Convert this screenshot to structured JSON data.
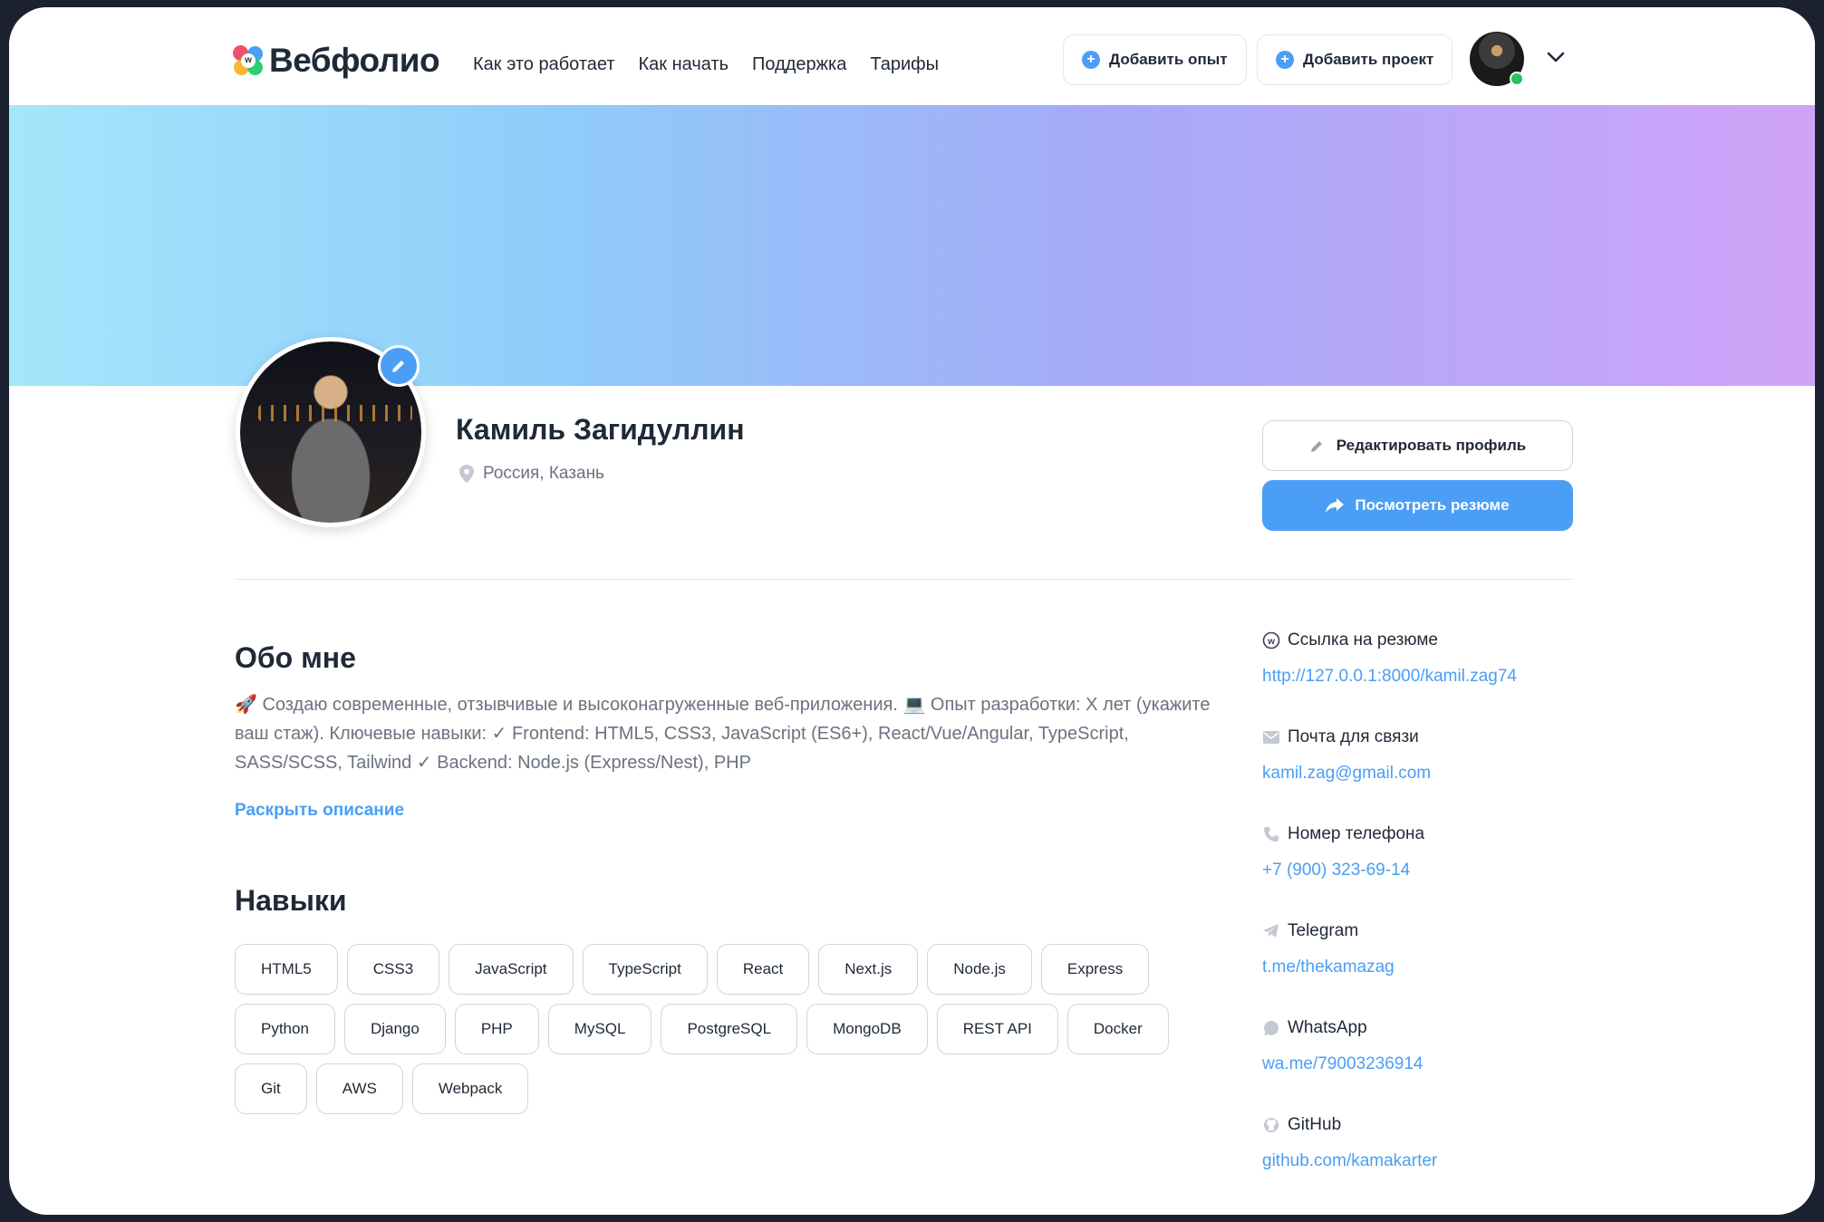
{
  "header": {
    "logo_text": "Вебфолио",
    "nav": [
      "Как это работает",
      "Как начать",
      "Поддержка",
      "Тарифы"
    ],
    "add_experience": "Добавить опыт",
    "add_project": "Добавить проект"
  },
  "profile": {
    "name": "Камиль Загидуллин",
    "location": "Россия, Казань",
    "edit_profile": "Редактировать профиль",
    "view_resume": "Посмотреть резюме"
  },
  "about": {
    "title": "Обо мне",
    "text": "🚀 Создаю современные, отзывчивые и высоконагруженные веб-приложения. 💻 Опыт разработки: X лет (укажите ваш стаж). Ключевые навыки: ✓ Frontend: HTML5, CSS3, JavaScript (ES6+), React/Vue/Angular, TypeScript, SASS/SCSS, Tailwind ✓ Backend: Node.js (Express/Nest), PHP",
    "reveal": "Раскрыть описание"
  },
  "skills": {
    "title": "Навыки",
    "rows": [
      [
        "HTML5",
        "CSS3",
        "JavaScript",
        "TypeScript",
        "React",
        "Next.js",
        "Node.js",
        "Express"
      ],
      [
        "Python",
        "Django",
        "PHP",
        "MySQL",
        "PostgreSQL",
        "MongoDB",
        "REST API",
        "Docker"
      ],
      [
        "Git",
        "AWS",
        "Webpack"
      ]
    ]
  },
  "contacts": [
    {
      "label": "Ссылка на резюме",
      "value": "http://127.0.0.1:8000/kamil.zag74",
      "icon": "webfolio-icon"
    },
    {
      "label": "Почта для связи",
      "value": "kamil.zag@gmail.com",
      "icon": "mail-icon"
    },
    {
      "label": "Номер телефона",
      "value": "+7 (900) 323-69-14",
      "icon": "phone-icon"
    },
    {
      "label": "Telegram",
      "value": "t.me/thekamazag",
      "icon": "telegram-icon"
    },
    {
      "label": "WhatsApp",
      "value": "wa.me/79003236914",
      "icon": "whatsapp-icon"
    },
    {
      "label": "GitHub",
      "value": "github.com/kamakarter",
      "icon": "github-icon"
    }
  ],
  "colors": {
    "accent": "#4a9ef5",
    "text": "#1f2937",
    "muted": "#6b7280",
    "online": "#22c55e"
  }
}
